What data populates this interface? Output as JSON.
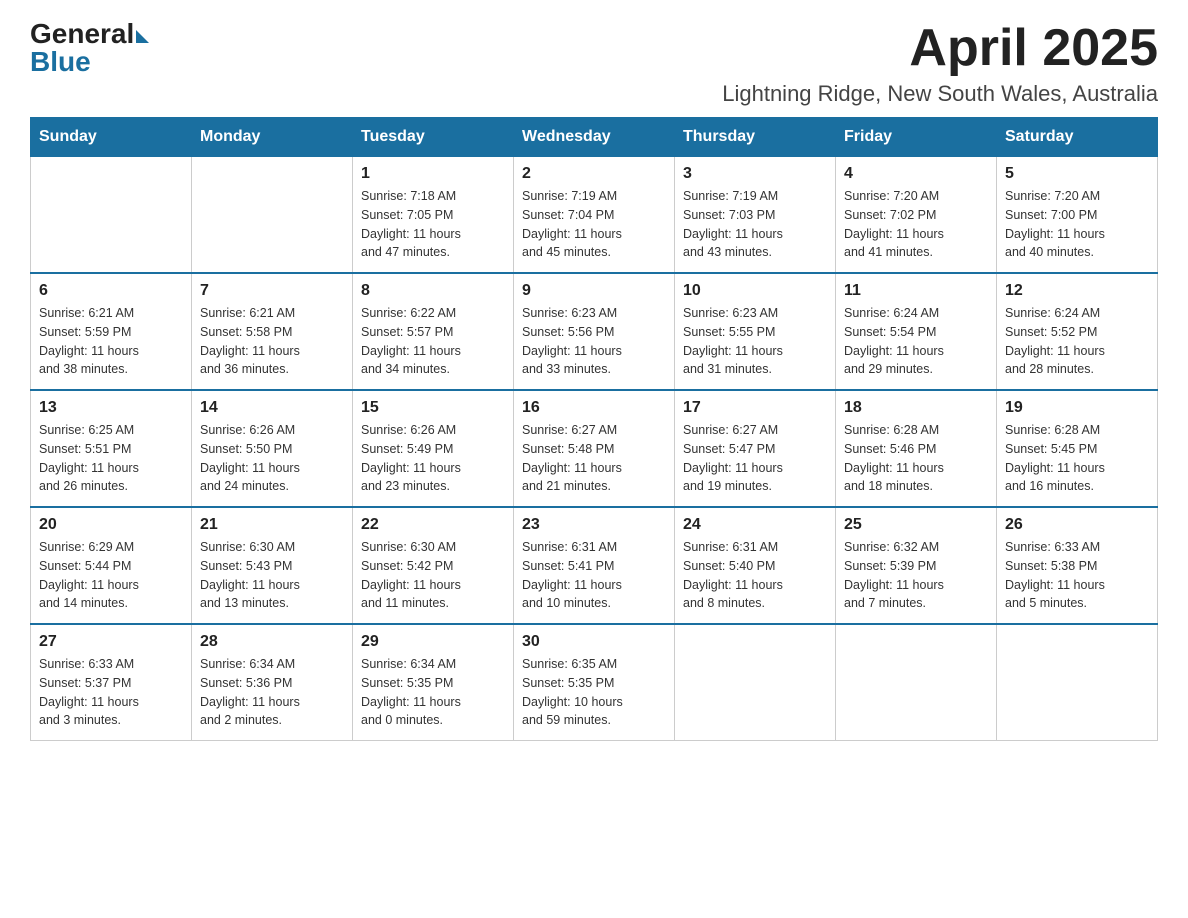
{
  "header": {
    "logo_general": "General",
    "logo_blue": "Blue",
    "month_title": "April 2025",
    "location": "Lightning Ridge, New South Wales, Australia"
  },
  "days_of_week": [
    "Sunday",
    "Monday",
    "Tuesday",
    "Wednesday",
    "Thursday",
    "Friday",
    "Saturday"
  ],
  "weeks": [
    [
      {
        "day": "",
        "info": ""
      },
      {
        "day": "",
        "info": ""
      },
      {
        "day": "1",
        "info": "Sunrise: 7:18 AM\nSunset: 7:05 PM\nDaylight: 11 hours\nand 47 minutes."
      },
      {
        "day": "2",
        "info": "Sunrise: 7:19 AM\nSunset: 7:04 PM\nDaylight: 11 hours\nand 45 minutes."
      },
      {
        "day": "3",
        "info": "Sunrise: 7:19 AM\nSunset: 7:03 PM\nDaylight: 11 hours\nand 43 minutes."
      },
      {
        "day": "4",
        "info": "Sunrise: 7:20 AM\nSunset: 7:02 PM\nDaylight: 11 hours\nand 41 minutes."
      },
      {
        "day": "5",
        "info": "Sunrise: 7:20 AM\nSunset: 7:00 PM\nDaylight: 11 hours\nand 40 minutes."
      }
    ],
    [
      {
        "day": "6",
        "info": "Sunrise: 6:21 AM\nSunset: 5:59 PM\nDaylight: 11 hours\nand 38 minutes."
      },
      {
        "day": "7",
        "info": "Sunrise: 6:21 AM\nSunset: 5:58 PM\nDaylight: 11 hours\nand 36 minutes."
      },
      {
        "day": "8",
        "info": "Sunrise: 6:22 AM\nSunset: 5:57 PM\nDaylight: 11 hours\nand 34 minutes."
      },
      {
        "day": "9",
        "info": "Sunrise: 6:23 AM\nSunset: 5:56 PM\nDaylight: 11 hours\nand 33 minutes."
      },
      {
        "day": "10",
        "info": "Sunrise: 6:23 AM\nSunset: 5:55 PM\nDaylight: 11 hours\nand 31 minutes."
      },
      {
        "day": "11",
        "info": "Sunrise: 6:24 AM\nSunset: 5:54 PM\nDaylight: 11 hours\nand 29 minutes."
      },
      {
        "day": "12",
        "info": "Sunrise: 6:24 AM\nSunset: 5:52 PM\nDaylight: 11 hours\nand 28 minutes."
      }
    ],
    [
      {
        "day": "13",
        "info": "Sunrise: 6:25 AM\nSunset: 5:51 PM\nDaylight: 11 hours\nand 26 minutes."
      },
      {
        "day": "14",
        "info": "Sunrise: 6:26 AM\nSunset: 5:50 PM\nDaylight: 11 hours\nand 24 minutes."
      },
      {
        "day": "15",
        "info": "Sunrise: 6:26 AM\nSunset: 5:49 PM\nDaylight: 11 hours\nand 23 minutes."
      },
      {
        "day": "16",
        "info": "Sunrise: 6:27 AM\nSunset: 5:48 PM\nDaylight: 11 hours\nand 21 minutes."
      },
      {
        "day": "17",
        "info": "Sunrise: 6:27 AM\nSunset: 5:47 PM\nDaylight: 11 hours\nand 19 minutes."
      },
      {
        "day": "18",
        "info": "Sunrise: 6:28 AM\nSunset: 5:46 PM\nDaylight: 11 hours\nand 18 minutes."
      },
      {
        "day": "19",
        "info": "Sunrise: 6:28 AM\nSunset: 5:45 PM\nDaylight: 11 hours\nand 16 minutes."
      }
    ],
    [
      {
        "day": "20",
        "info": "Sunrise: 6:29 AM\nSunset: 5:44 PM\nDaylight: 11 hours\nand 14 minutes."
      },
      {
        "day": "21",
        "info": "Sunrise: 6:30 AM\nSunset: 5:43 PM\nDaylight: 11 hours\nand 13 minutes."
      },
      {
        "day": "22",
        "info": "Sunrise: 6:30 AM\nSunset: 5:42 PM\nDaylight: 11 hours\nand 11 minutes."
      },
      {
        "day": "23",
        "info": "Sunrise: 6:31 AM\nSunset: 5:41 PM\nDaylight: 11 hours\nand 10 minutes."
      },
      {
        "day": "24",
        "info": "Sunrise: 6:31 AM\nSunset: 5:40 PM\nDaylight: 11 hours\nand 8 minutes."
      },
      {
        "day": "25",
        "info": "Sunrise: 6:32 AM\nSunset: 5:39 PM\nDaylight: 11 hours\nand 7 minutes."
      },
      {
        "day": "26",
        "info": "Sunrise: 6:33 AM\nSunset: 5:38 PM\nDaylight: 11 hours\nand 5 minutes."
      }
    ],
    [
      {
        "day": "27",
        "info": "Sunrise: 6:33 AM\nSunset: 5:37 PM\nDaylight: 11 hours\nand 3 minutes."
      },
      {
        "day": "28",
        "info": "Sunrise: 6:34 AM\nSunset: 5:36 PM\nDaylight: 11 hours\nand 2 minutes."
      },
      {
        "day": "29",
        "info": "Sunrise: 6:34 AM\nSunset: 5:35 PM\nDaylight: 11 hours\nand 0 minutes."
      },
      {
        "day": "30",
        "info": "Sunrise: 6:35 AM\nSunset: 5:35 PM\nDaylight: 10 hours\nand 59 minutes."
      },
      {
        "day": "",
        "info": ""
      },
      {
        "day": "",
        "info": ""
      },
      {
        "day": "",
        "info": ""
      }
    ]
  ]
}
